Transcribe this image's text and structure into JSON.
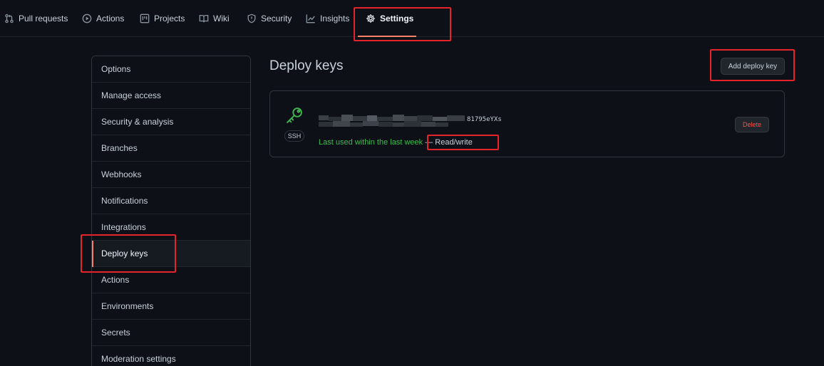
{
  "tabs": [
    {
      "label": "Pull requests",
      "icon": "pull-request-icon"
    },
    {
      "label": "Actions",
      "icon": "play-icon"
    },
    {
      "label": "Projects",
      "icon": "project-icon"
    },
    {
      "label": "Wiki",
      "icon": "book-icon"
    },
    {
      "label": "Security",
      "icon": "shield-icon"
    },
    {
      "label": "Insights",
      "icon": "graph-icon"
    },
    {
      "label": "Settings",
      "icon": "gear-icon",
      "selected": true
    }
  ],
  "sidebar": {
    "items": [
      {
        "label": "Options"
      },
      {
        "label": "Manage access"
      },
      {
        "label": "Security & analysis"
      },
      {
        "label": "Branches"
      },
      {
        "label": "Webhooks"
      },
      {
        "label": "Notifications"
      },
      {
        "label": "Integrations"
      },
      {
        "label": "Deploy keys",
        "selected": true
      },
      {
        "label": "Actions"
      },
      {
        "label": "Environments"
      },
      {
        "label": "Secrets"
      },
      {
        "label": "Moderation settings"
      }
    ]
  },
  "main": {
    "title": "Deploy keys",
    "add_button": "Add deploy key",
    "key": {
      "icon": "key-icon",
      "type_badge": "SSH",
      "fingerprint_visible_tail": "81795eYXs",
      "last_used": "Last used within the last week",
      "access": "— Read/write",
      "delete_button": "Delete"
    }
  },
  "colors": {
    "accent_underline": "#f78166",
    "success": "#3fb950",
    "danger": "#f85149",
    "annotation": "#e5232b"
  }
}
